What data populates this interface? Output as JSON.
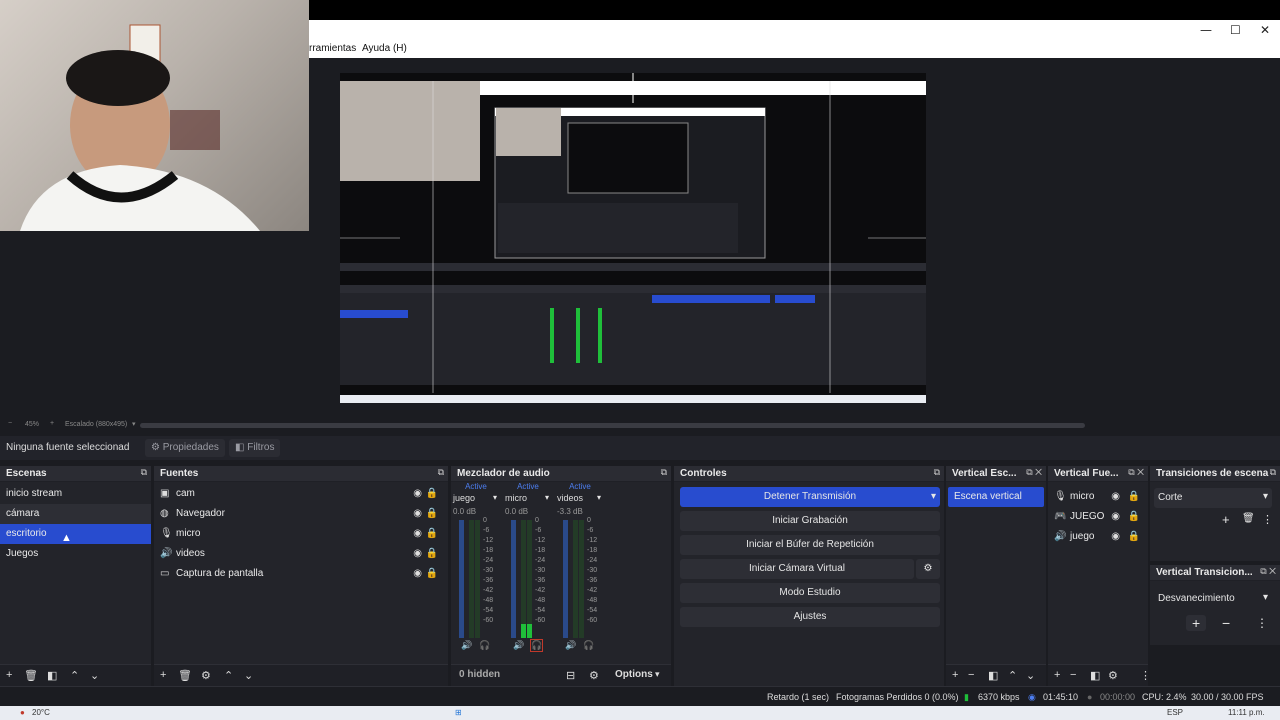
{
  "menu": {
    "tools": "rramientas",
    "help": "Ayuda (H)"
  },
  "window": {
    "minimize_icon": "minimize-icon",
    "maximize_icon": "maximize-icon",
    "close_icon": "close-icon"
  },
  "preview": {
    "zoom": "45%",
    "scale": "Escalado (880x495)"
  },
  "properties": {
    "no_source": "Ninguna fuente seleccionad",
    "properties_label": "Propiedades",
    "filters_label": "Filtros"
  },
  "scenes": {
    "title": "Escenas",
    "items": [
      {
        "label": "inicio stream"
      },
      {
        "label": "cámara"
      },
      {
        "label": "escritorio"
      },
      {
        "label": "Juegos"
      }
    ],
    "selected_index": 2
  },
  "sources": {
    "title": "Fuentes",
    "items": [
      {
        "label": "cam",
        "icon": "camera-icon"
      },
      {
        "label": "Navegador",
        "icon": "globe-icon"
      },
      {
        "label": "micro",
        "icon": "microphone-icon"
      },
      {
        "label": "videos",
        "icon": "speaker-icon"
      },
      {
        "label": "Captura de pantalla",
        "icon": "monitor-icon"
      }
    ]
  },
  "mixer": {
    "title": "Mezclador de audio",
    "channels": [
      {
        "active": "Active",
        "name": "juego",
        "db": "0.0 dB",
        "level": 0.0
      },
      {
        "active": "Active",
        "name": "micro",
        "db": "0.0 dB",
        "level": 0.12
      },
      {
        "active": "Active",
        "name": "videos",
        "db": "-3.3 dB",
        "level": 0.0
      }
    ],
    "scale_labels": [
      "0",
      "-6",
      "-12",
      "-18",
      "-24",
      "-30",
      "-36",
      "-42",
      "-48",
      "-54",
      "-60"
    ],
    "hidden": "0 hidden",
    "options": "Options"
  },
  "controls": {
    "title": "Controles",
    "stop_stream": "Detener Transmisión",
    "start_recording": "Iniciar Grabación",
    "replay_buffer": "Iniciar el Búfer de Repetición",
    "virtual_camera": "Iniciar Cámara Virtual",
    "studio_mode": "Modo Estudio",
    "settings": "Ajustes"
  },
  "vertical_scenes": {
    "title": "Vertical Esc...",
    "item": "Escena vertical"
  },
  "vertical_sources": {
    "title": "Vertical Fue...",
    "items": [
      {
        "label": "micro",
        "icon": "microphone-icon"
      },
      {
        "label": "JUEGO",
        "icon": "gamepad-icon"
      },
      {
        "label": "juego",
        "icon": "speaker-icon"
      }
    ]
  },
  "transitions": {
    "title": "Transiciones de escena",
    "value": "Corte"
  },
  "vertical_transitions": {
    "title": "Vertical Transicion...",
    "value": "Desvanecimiento"
  },
  "status": {
    "delay": "Retardo (1 sec)",
    "dropped": "Fotogramas Perdidos 0 (0.0%)",
    "kbps": "6370 kbps",
    "stream_time": "01:45:10",
    "rec_time": "00:00:00",
    "cpu": "CPU: 2.4%",
    "fps": "30.00 / 30.00 FPS"
  },
  "taskbar": {
    "weather": "20°C",
    "lang": "ESP",
    "time": "11:11 p.m."
  },
  "colors": {
    "accent": "#284ccf",
    "active_text": "#4d7ef0",
    "meter_green": "#1fbf3a",
    "meter_yellow": "#c9b800",
    "meter_red": "#c0392b"
  }
}
